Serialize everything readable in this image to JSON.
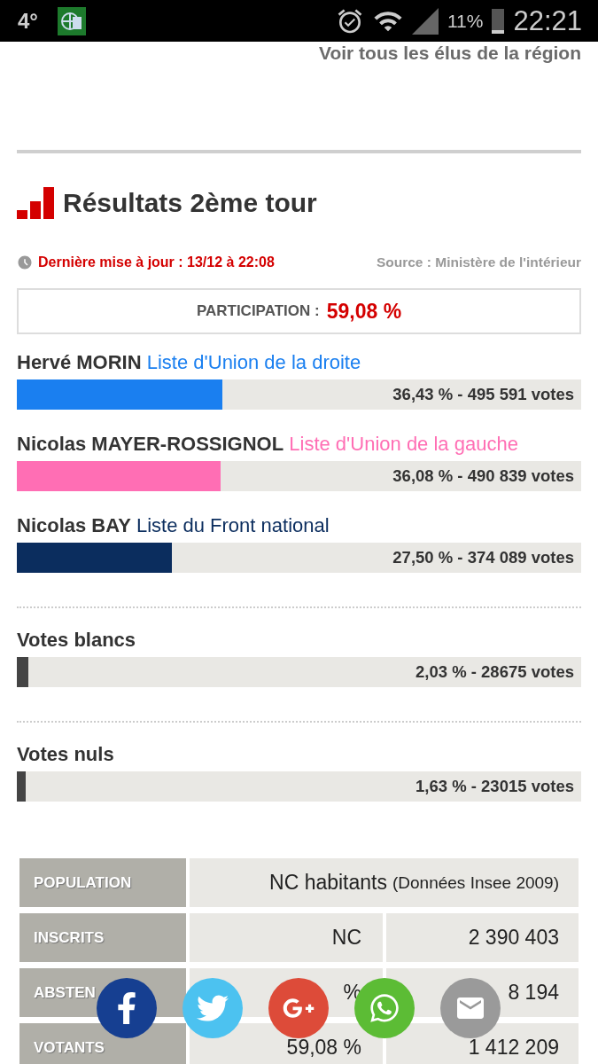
{
  "status_bar": {
    "temperature": "4°",
    "battery": "11%",
    "time": "22:21"
  },
  "link": "Voir tous les élus de la région",
  "section": {
    "title": "Résultats 2ème tour",
    "updated": "Dernière mise à jour : 13/12 à 22:08",
    "source": "Source : Ministère de l'intérieur",
    "participation_label": "PARTICIPATION :",
    "participation_value": "59,08 %"
  },
  "candidates": [
    {
      "name": "Hervé MORIN",
      "list": "Liste d'Union de la droite",
      "color": "#1a7ff0",
      "level": 0.3643,
      "result": "36,43 % - 495 591 votes"
    },
    {
      "name": "Nicolas MAYER-ROSSIGNOL",
      "list": "Liste d'Union de la gauche",
      "color": "#ff6eb4",
      "level": 0.3608,
      "result": "36,08 % - 490 839 votes"
    },
    {
      "name": "Nicolas BAY",
      "list": "Liste du Front national",
      "color": "#0b2d5e",
      "level": 0.275,
      "result": "27,50 % - 374 089 votes"
    }
  ],
  "other_votes": [
    {
      "label": "Votes blancs",
      "level": 0.0203,
      "result": "2,03 % - 28675 votes"
    },
    {
      "label": "Votes nuls",
      "level": 0.0163,
      "result": "1,63 % - 23015 votes"
    }
  ],
  "stats": [
    {
      "label": "POPULATION",
      "value": "NC habitants",
      "note": "(Données Insee 2009)"
    },
    {
      "label": "INSCRITS",
      "cells": [
        "NC",
        "2 390 403"
      ]
    },
    {
      "label": "ABSTEN",
      "cells": [
        "%",
        "8 194"
      ]
    },
    {
      "label": "VOTANTS",
      "cells": [
        "59,08 %",
        "1 412 209"
      ]
    }
  ],
  "share_buttons": [
    {
      "kind": "facebook"
    },
    {
      "kind": "twitter"
    },
    {
      "kind": "google-plus"
    },
    {
      "kind": "whatsapp"
    },
    {
      "kind": "email"
    }
  ]
}
